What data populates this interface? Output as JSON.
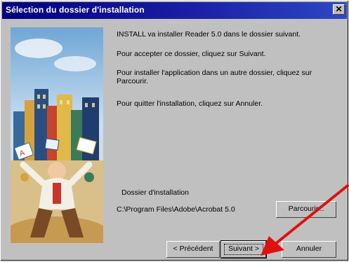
{
  "window": {
    "title": "Sélection du dossier d'installation",
    "close_glyph": "✕"
  },
  "messages": {
    "line1": "INSTALL va installer Reader 5.0 dans le dossier suivant.",
    "line2": "Pour accepter ce dossier, cliquez sur Suivant.",
    "line3": "Pour installer l'application dans un autre dossier, cliquez sur Parcourir.",
    "line4": "Pour quitter l'installation, cliquez sur Annuler."
  },
  "folder": {
    "label": "Dossier d'installation",
    "path": "C:\\Program Files\\Adobe\\Acrobat 5.0"
  },
  "buttons": {
    "browse": "Parcourir...",
    "previous": "< Précédent",
    "next": "Suivant >",
    "cancel": "Annuler"
  },
  "colors": {
    "titlebar": "#00007c",
    "arrow": "#e01010",
    "sky": "#9cc6e6"
  },
  "icons": {
    "close": "close-icon",
    "illustration": "city-illustration",
    "pointer": "red-arrow-annotation"
  }
}
